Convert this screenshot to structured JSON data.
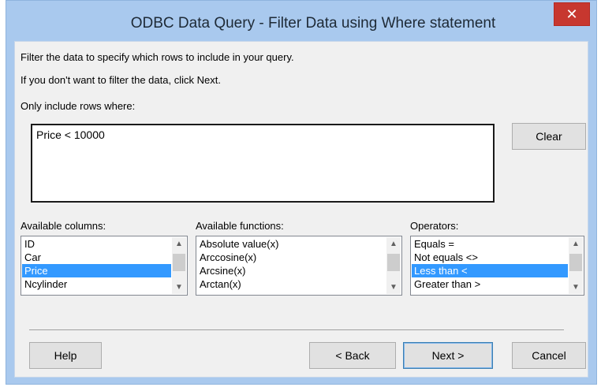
{
  "window": {
    "title": "ODBC Data Query - Filter Data using Where statement",
    "close_glyph": "✕"
  },
  "instructions": {
    "line1": "Filter the data to specify which rows to include in your query.",
    "line2": "If you don't want to filter the data, click Next.",
    "rows_label": "Only include rows where:"
  },
  "where_box": {
    "value": "Price < 10000"
  },
  "buttons": {
    "clear": "Clear",
    "help": "Help",
    "back": "< Back",
    "next": "Next >",
    "cancel": "Cancel"
  },
  "columns": {
    "label": "Available columns:",
    "items": [
      "ID",
      "Car",
      "Price",
      "Ncylinder"
    ],
    "selected_index": 2
  },
  "functions": {
    "label": "Available functions:",
    "items": [
      "Absolute value(x)",
      "Arccosine(x)",
      "Arcsine(x)",
      "Arctan(x)"
    ]
  },
  "operators": {
    "label": "Operators:",
    "items": [
      "Equals =",
      "Not equals <>",
      "Less than <",
      "Greater than >"
    ],
    "selected_index": 2
  },
  "scroll_glyphs": {
    "up": "▲",
    "down": "▼"
  },
  "colors": {
    "title_bar": "#a9c9ee",
    "close_button": "#c7372f",
    "selection": "#3399ff"
  }
}
